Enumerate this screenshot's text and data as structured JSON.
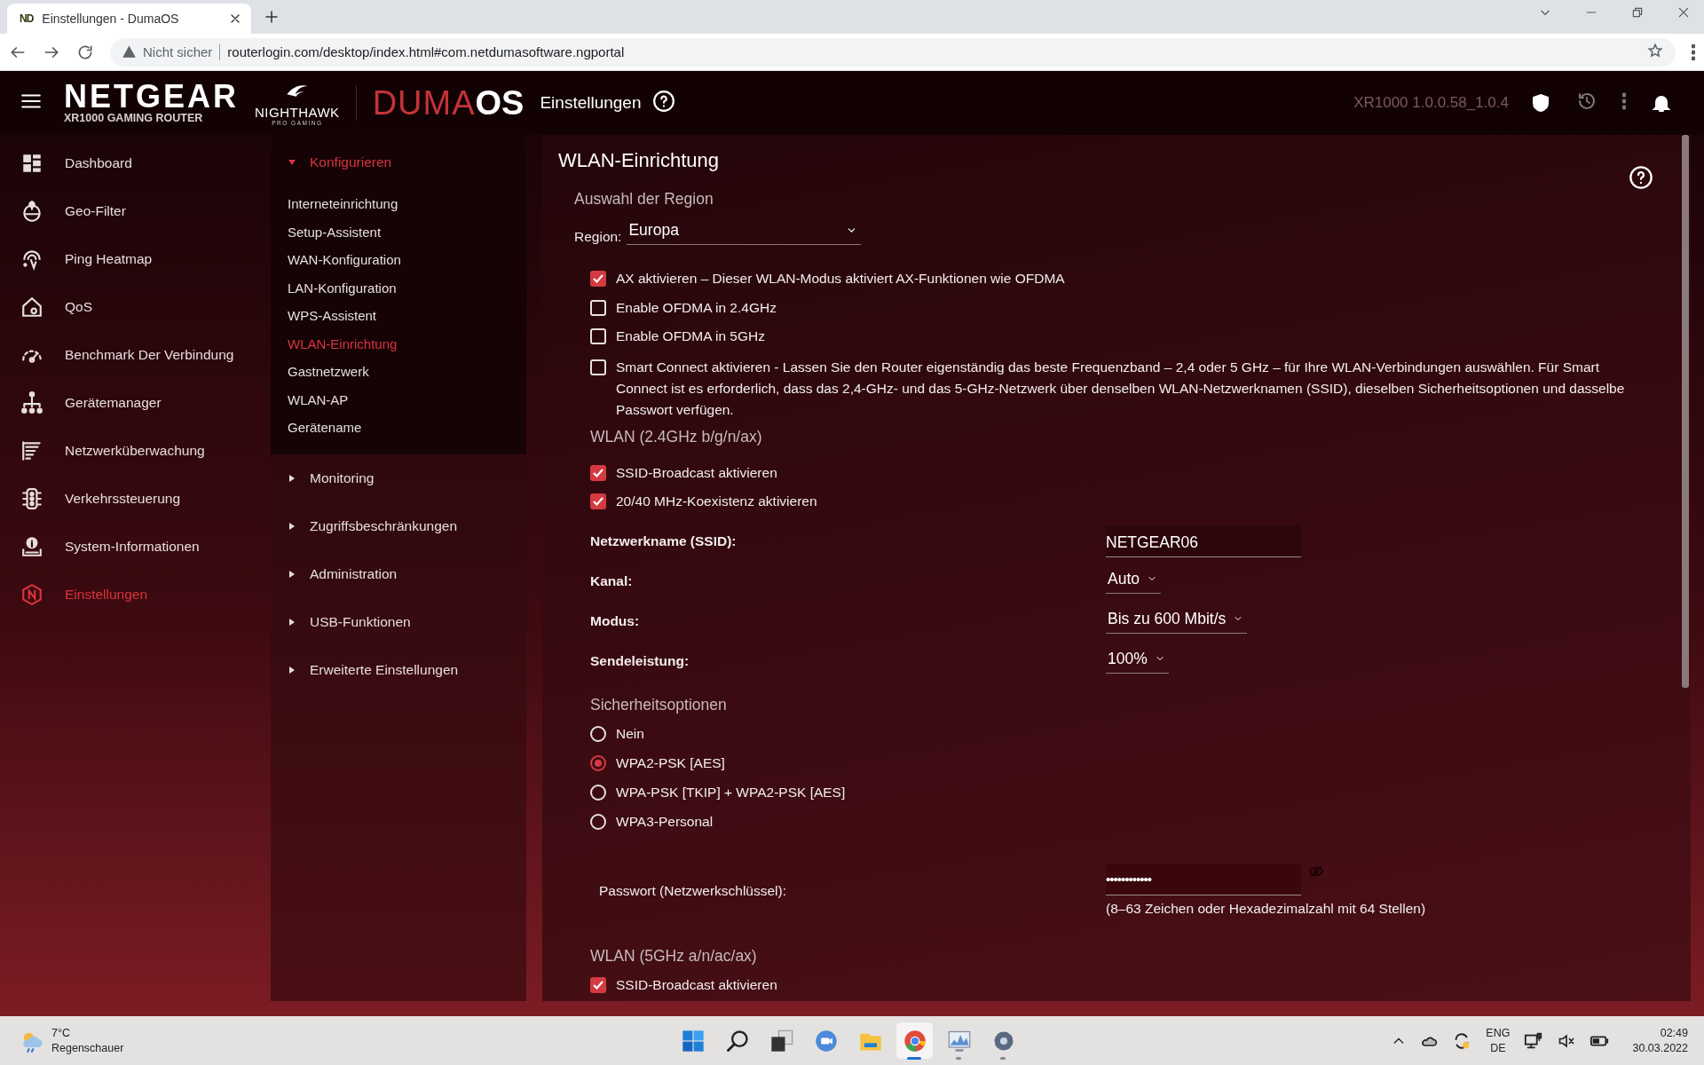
{
  "browser": {
    "tab_icon": "ND",
    "tab_title": "Einstellungen - DumaOS",
    "security_label": "Nicht sicher",
    "url": "routerlogin.com/desktop/index.html#com.netdumasoftware.ngportal"
  },
  "header": {
    "brand": "NETGEAR",
    "model": "XR1000 GAMING ROUTER",
    "sub_brand": "NIGHTHAWK",
    "sub_brand_tagline": "PRO GAMING",
    "product_prefix": "DUMA",
    "product_suffix": "OS",
    "page_title": "Einstellungen",
    "firmware": "XR1000 1.0.0.58_1.0.4"
  },
  "sidebar": {
    "items": [
      {
        "label": "Dashboard",
        "selected": false
      },
      {
        "label": "Geo-Filter",
        "selected": false
      },
      {
        "label": "Ping Heatmap",
        "selected": false
      },
      {
        "label": "QoS",
        "selected": false
      },
      {
        "label": "Benchmark Der Verbindung",
        "selected": false
      },
      {
        "label": "Gerätemanager",
        "selected": false
      },
      {
        "label": "Netzwerküberwachung",
        "selected": false
      },
      {
        "label": "Verkehrssteuerung",
        "selected": false
      },
      {
        "label": "System-Informationen",
        "selected": false
      },
      {
        "label": "Einstellungen",
        "selected": true
      }
    ]
  },
  "submenu": {
    "groups": [
      {
        "label": "Konfigurieren",
        "expanded": true,
        "children": [
          {
            "label": "Interneteinrichtung",
            "selected": false
          },
          {
            "label": "Setup-Assistent",
            "selected": false
          },
          {
            "label": "WAN-Konfiguration",
            "selected": false
          },
          {
            "label": "LAN-Konfiguration",
            "selected": false
          },
          {
            "label": "WPS-Assistent",
            "selected": false
          },
          {
            "label": "WLAN-Einrichtung",
            "selected": true
          },
          {
            "label": "Gastnetzwerk",
            "selected": false
          },
          {
            "label": "WLAN-AP",
            "selected": false
          },
          {
            "label": "Gerätename",
            "selected": false
          }
        ]
      },
      {
        "label": "Monitoring",
        "expanded": false
      },
      {
        "label": "Zugriffsbeschränkungen",
        "expanded": false
      },
      {
        "label": "Administration",
        "expanded": false
      },
      {
        "label": "USB-Funktionen",
        "expanded": false
      },
      {
        "label": "Erweiterte Einstellungen",
        "expanded": false
      }
    ]
  },
  "content": {
    "title": "WLAN-Einrichtung",
    "region": {
      "heading": "Auswahl der Region",
      "label": "Region:",
      "value": "Europa"
    },
    "options": [
      {
        "label": "AX aktivieren – Dieser WLAN-Modus aktiviert AX-Funktionen wie OFDMA",
        "checked": true
      },
      {
        "label": "Enable OFDMA in 2.4GHz",
        "checked": false
      },
      {
        "label": "Enable OFDMA in 5GHz",
        "checked": false
      },
      {
        "label": "Smart Connect aktivieren - Lassen Sie den Router eigenständig das beste Frequenzband – 2,4 oder 5 GHz – für Ihre WLAN-Verbindungen auswählen. Für Smart Connect ist es erforderlich, dass das 2,4-GHz- und das 5-GHz-Netzwerk über denselben WLAN-Netzwerknamen (SSID), dieselben Sicherheitsoptionen und dasselbe Passwort verfügen.",
        "checked": false
      }
    ],
    "wlan24": {
      "heading": "WLAN (2.4GHz b/g/n/ax)",
      "options": [
        {
          "label": "SSID-Broadcast aktivieren",
          "checked": true
        },
        {
          "label": "20/40 MHz-Koexistenz aktivieren",
          "checked": true
        }
      ],
      "fields": [
        {
          "kind": "text",
          "label": "Netzwerkname (SSID):",
          "value": "NETGEAR06"
        },
        {
          "kind": "select",
          "label": "Kanal:",
          "value": "Auto"
        },
        {
          "kind": "select",
          "label": "Modus:",
          "value": "Bis zu 600 Mbit/s"
        },
        {
          "kind": "select",
          "label": "Sendeleistung:",
          "value": "100%"
        }
      ],
      "security": {
        "heading": "Sicherheitsoptionen",
        "options": [
          {
            "label": "Nein",
            "selected": false
          },
          {
            "label": "WPA2-PSK [AES]",
            "selected": true
          },
          {
            "label": "WPA-PSK [TKIP] + WPA2-PSK [AES]",
            "selected": false
          },
          {
            "label": "WPA3-Personal",
            "selected": false
          }
        ]
      },
      "password": {
        "label": "Passwort (Netzwerkschlüssel):",
        "value": "••••••••••••",
        "hint": "(8–63 Zeichen oder Hexadezimalzahl mit 64 Stellen)"
      }
    },
    "wlan5": {
      "heading": "WLAN (5GHz a/n/ac/ax)",
      "options": [
        {
          "label": "SSID-Broadcast aktivieren",
          "checked": true
        }
      ]
    }
  },
  "taskbar": {
    "weather_temp": "7°C",
    "weather_text": "Regenschauer",
    "apps": [
      {
        "selected": false,
        "running": false
      },
      {
        "selected": false,
        "running": false
      },
      {
        "selected": false,
        "running": false
      },
      {
        "selected": false,
        "running": false
      },
      {
        "selected": false,
        "running": false
      },
      {
        "selected": true,
        "running": true
      },
      {
        "selected": false,
        "running": true
      },
      {
        "selected": false,
        "running": true
      }
    ],
    "language": "ENG",
    "layout": "DE",
    "time": "02:49",
    "date": "30.03.2022"
  }
}
